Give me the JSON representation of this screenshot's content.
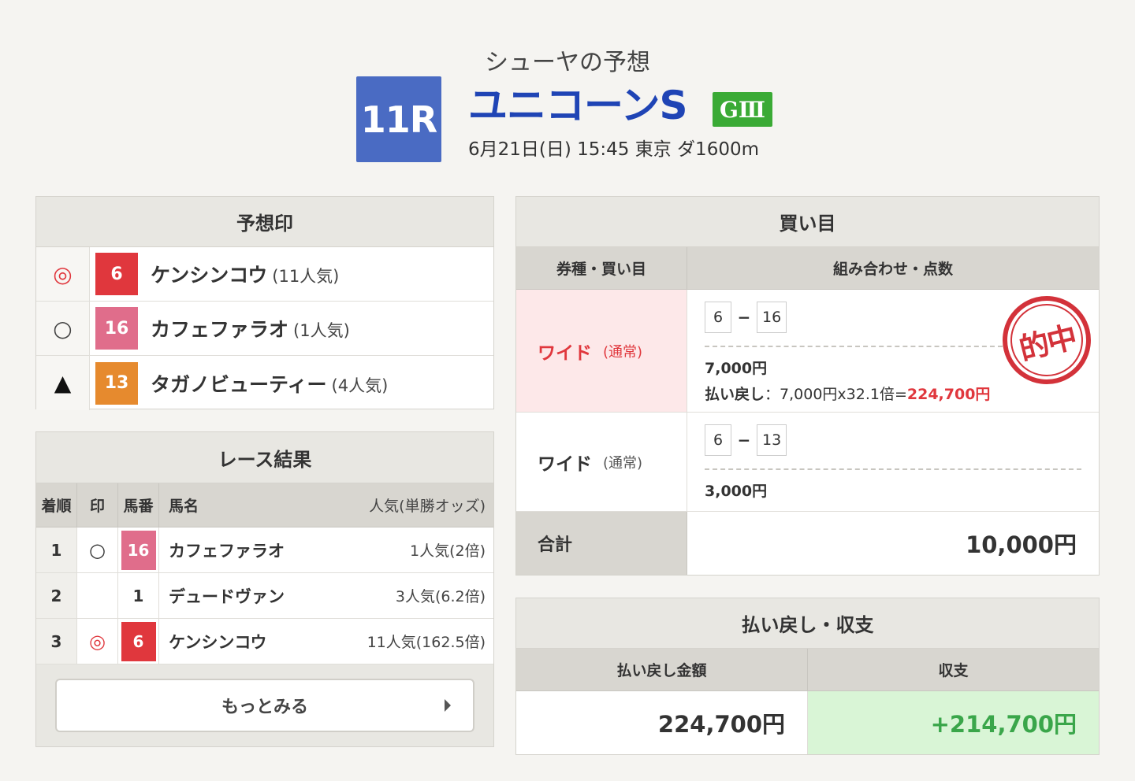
{
  "header": {
    "subtitle": "シューヤの予想",
    "race_no": "11R",
    "race_name": "ユニコーンS",
    "grade": "GⅢ",
    "info": "6月21日(日) 15:45 東京 ダ1600m"
  },
  "prediction": {
    "title": "予想印",
    "rows": [
      {
        "mark": "◎",
        "num": "6",
        "name": "ケンシンコウ",
        "pop": "(11人気)"
      },
      {
        "mark": "○",
        "num": "16",
        "name": "カフェファラオ",
        "pop": "(1人気)"
      },
      {
        "mark": "▲",
        "num": "13",
        "name": "タガノビューティー",
        "pop": "(4人気)"
      }
    ]
  },
  "result": {
    "title": "レース結果",
    "headers": {
      "pos": "着順",
      "mark": "印",
      "num": "馬番",
      "name": "馬名",
      "pop": "人気(単勝オッズ)"
    },
    "rows": [
      {
        "pos": "1",
        "mark": "○",
        "num": "16",
        "name": "カフェファラオ",
        "pop": "1人気(2倍)"
      },
      {
        "pos": "2",
        "mark": "",
        "num": "1",
        "name": "デュードヴァン",
        "pop": "3人気(6.2倍)"
      },
      {
        "pos": "3",
        "mark": "◎",
        "num": "6",
        "name": "ケンシンコウ",
        "pop": "11人気(162.5倍)"
      }
    ],
    "more_label": "もっとみる"
  },
  "bets": {
    "title": "買い目",
    "head_type": "券種・買い目",
    "head_combo": "組み合わせ・点数",
    "rows": [
      {
        "type": "ワイド",
        "sub": "(通常)",
        "combo": [
          "6",
          "16"
        ],
        "amount": "7,000円",
        "payout_label": "払い戻し",
        "payout_calc": "：7,000円x32.1倍=",
        "payout_value": "224,700円",
        "stamp": "的中"
      },
      {
        "type": "ワイド",
        "sub": "(通常)",
        "combo": [
          "6",
          "13"
        ],
        "amount": "3,000円"
      }
    ],
    "total_label": "合計",
    "total_value": "10,000円"
  },
  "payout": {
    "title": "払い戻し・収支",
    "head_payout": "払い戻し金額",
    "head_balance": "収支",
    "payout_value": "224,700円",
    "balance_value": "+214,700円"
  }
}
